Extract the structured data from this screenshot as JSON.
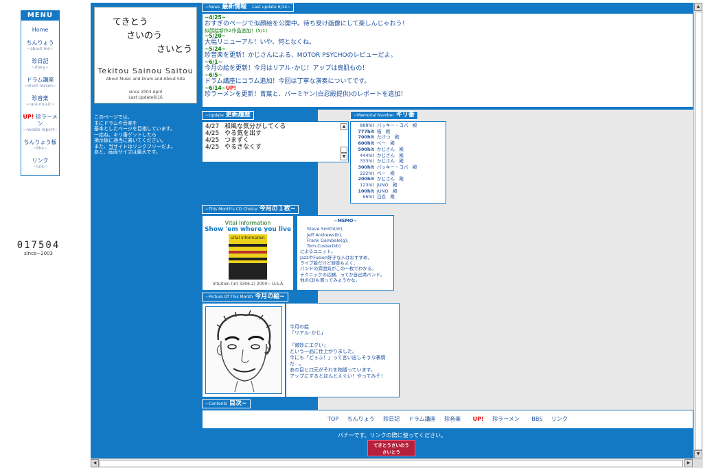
{
  "menu": {
    "title": "MENU",
    "items": [
      {
        "label": "Home",
        "sub": ""
      },
      {
        "label": "ちんりょう",
        "sub": "~about me~"
      },
      {
        "label": "珍日記",
        "sub": "~diary~"
      },
      {
        "label": "ドラム講座",
        "sub": "~drum lesson~"
      },
      {
        "label": "珍音楽",
        "sub": "~rare music~"
      },
      {
        "label": "珍ラーメン",
        "sub": "~noodle report~",
        "badge": "UP!"
      },
      {
        "label": "ちんりょう板",
        "sub": "~bbs~"
      },
      {
        "label": "リンク",
        "sub": "~link~"
      }
    ]
  },
  "counter": {
    "value": "017504",
    "since": "since~2003"
  },
  "logo": {
    "line1": "てきとう",
    "line2": "さいのう",
    "line3": "さいとう",
    "name": "Tekitou Sainou Saitou",
    "subtitle": "About Music and Drum and About Site",
    "since": "since 2003 April",
    "last_update": "Last Update6/16"
  },
  "intro": [
    "このページでは、",
    "主にドラムや音楽を",
    "基本としたページを目指しています。",
    "一応ね。キリ番ゲットしたら",
    "掲示板に適当に書いてください。",
    "また、当サイトはリンクフリーだよ。",
    "あと、画面サイズは最大です。"
  ],
  "news": {
    "title_small": "~News",
    "title": "最新情報",
    "update": "Last update 6/14~",
    "entries": [
      {
        "date": "~4/25~",
        "text": "おすぎのページで似顔絵を公開中。待ち受け画像にして楽しんじゃおう！",
        "note": "似顔絵新作2作品追加！(5/1)",
        "up": ""
      },
      {
        "date": "~5/20~",
        "text": "大幅リニューアル！いや、何となくね。",
        "note": "",
        "up": ""
      },
      {
        "date": "~5/24~",
        "text": "珍音楽を更新！かじさんによる、MOTOR PSYCHOのレビューだよ。",
        "note": "",
        "up": ""
      },
      {
        "date": "~6/1~",
        "text": "今月の絵を更新！今月はリアル･かじ！アップは鳥肌もの！",
        "note": "",
        "up": ""
      },
      {
        "date": "~6/5~",
        "text": "ドラム講座にコラム追加！今回は丁寧な演奏についてです。",
        "note": "",
        "up": ""
      },
      {
        "date": "~6/14~",
        "text": "珍ラーメンを更新！青葉と、バーミヤン(白忍殿提供)のレポートを追加！",
        "note": "",
        "up": "UP!"
      }
    ]
  },
  "update_log": {
    "title_small": "~Update",
    "title": "更新履歴",
    "rows": [
      {
        "date": "4/27",
        "text": "和風な気分がしてくる"
      },
      {
        "date": "4/25",
        "text": "やる気を出す"
      },
      {
        "date": "4/25",
        "text": "つまずく"
      },
      {
        "date": "4/25",
        "text": "やるきなくす"
      }
    ]
  },
  "memorial": {
    "title_small": "~Memorial Number",
    "title": "キリ番",
    "rows": [
      {
        "hit": "888hit",
        "bold": false,
        "name": "パッキー・コバ　殿"
      },
      {
        "hit": "777hit",
        "bold": true,
        "name": "楢　殿"
      },
      {
        "hit": "700hit",
        "bold": true,
        "name": "たけつ　殿"
      },
      {
        "hit": "600hit",
        "bold": true,
        "name": "ベー　殿"
      },
      {
        "hit": "500hit",
        "bold": true,
        "name": "かじさん　殿"
      },
      {
        "hit": "444hit",
        "bold": false,
        "name": "かじさん　殿"
      },
      {
        "hit": "333hit",
        "bold": false,
        "name": "かじさん　殿"
      },
      {
        "hit": "300hit",
        "bold": true,
        "name": "パッキー・コバ　殿"
      },
      {
        "hit": "222hit",
        "bold": false,
        "name": "ベー　殿"
      },
      {
        "hit": "200hit",
        "bold": true,
        "name": "かじさん　殿"
      },
      {
        "hit": "123hit",
        "bold": false,
        "name": "JUNO　殿"
      },
      {
        "hit": "100hit",
        "bold": true,
        "name": "JUNO　殿"
      },
      {
        "hit": "66hit",
        "bold": false,
        "name": "白忍　殿"
      }
    ]
  },
  "cd": {
    "title_small": "~This Month's CD Choice",
    "title": "今月の１枚~",
    "artist": "Vital Information",
    "album": "Show 'em where you live",
    "cover_text": "vital information",
    "label": "Intuition (int 3306 2) 2000~ U.S.A",
    "memo_title": "~MEMO~",
    "members": [
      "Steve Smith(dr),",
      "Jeff Andrews(b),",
      "Frank Gambale(g),",
      "Tom Coster(kb)"
    ],
    "memo_lines": [
      "によるユニット。",
      "JazzやFusion好きな人はおすすめ。",
      "ライブ版だけど録音もよく、",
      "バンドの雰囲気がこの一枚でわかる。",
      "テクニックの応酬、ってか自己満バンド。",
      "他のCDも買ってみようかな。"
    ]
  },
  "picture": {
    "title_small": "~Picture Of This Month",
    "title": "今月の絵~",
    "lines": [
      "今月の絵",
      "「リアル･かじ」",
      "",
      "「微妙にエグい」",
      "という一品に仕上がりました。",
      "今にも「どぅふ！」って言い出しそうな表情だ…。",
      "あの目と口元がそれを物語っています。",
      "アップにするとほんとえぐい！やってみそ！"
    ]
  },
  "contents": {
    "title_small": "~Contents",
    "title": "目次~",
    "links": [
      {
        "label": "TOP",
        "badge": ""
      },
      {
        "label": "ちんりょう",
        "badge": ""
      },
      {
        "label": "珍日記",
        "badge": ""
      },
      {
        "label": "ドラム講座",
        "badge": ""
      },
      {
        "label": "珍音楽",
        "badge": ""
      },
      {
        "label": "珍ラーメン",
        "badge": "UP!"
      },
      {
        "label": "BBS",
        "badge": ""
      },
      {
        "label": "リンク",
        "badge": ""
      }
    ]
  },
  "banner": {
    "note": "バナーです。リンクの際に使ってください。",
    "line1": "てきとうさいのう",
    "line2": "さいとう"
  },
  "scroll": {
    "up": "▲",
    "down": "▼",
    "left": "◀",
    "right": "▶"
  },
  "colors": {
    "panel_blue": "#1479c5",
    "text_blue": "#1a4d9a",
    "date_green": "#0a7a0a",
    "up_red": "#e00000",
    "banner_red": "#b5213a"
  }
}
